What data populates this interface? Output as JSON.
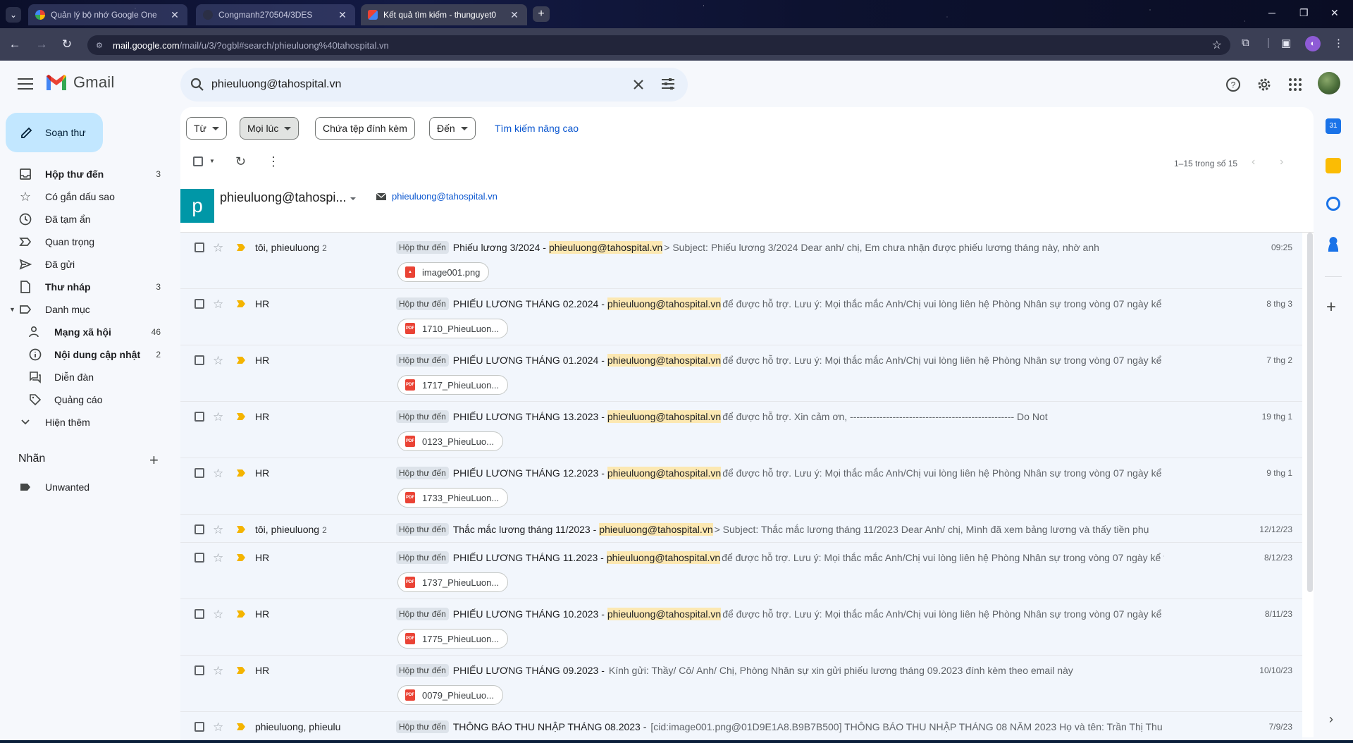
{
  "browser": {
    "tabs": [
      {
        "title": "Quản lý bộ nhớ Google One",
        "active": false
      },
      {
        "title": "Congmanh270504/3DES",
        "active": false
      },
      {
        "title": "Kết quả tìm kiếm - thunguyet0",
        "active": true
      }
    ],
    "url_host": "mail.google.com",
    "url_path": "/mail/u/3/?ogbl#search/phieuluong%40tahospital.vn"
  },
  "gmail": {
    "wordmark": "Gmail",
    "search_value": "phieuluong@tahospital.vn",
    "compose_label": "Soạn thư"
  },
  "sidebar": {
    "items": [
      {
        "label": "Hộp thư đến",
        "count": "3",
        "icon": "inbox-icon"
      },
      {
        "label": "Có gắn dấu sao",
        "count": "",
        "icon": "star-icon"
      },
      {
        "label": "Đã tạm ẩn",
        "count": "",
        "icon": "clock-icon"
      },
      {
        "label": "Quan trọng",
        "count": "",
        "icon": "important-icon"
      },
      {
        "label": "Đã gửi",
        "count": "",
        "icon": "send-icon"
      },
      {
        "label": "Thư nháp",
        "count": "3",
        "icon": "draft-icon"
      },
      {
        "label": "Danh mục",
        "count": "",
        "icon": "label-icon"
      },
      {
        "label": "Mạng xã hội",
        "count": "46",
        "icon": "people-icon"
      },
      {
        "label": "Nội dung cập nhật",
        "count": "2",
        "icon": "info-icon"
      },
      {
        "label": "Diễn đàn",
        "count": "",
        "icon": "forum-icon"
      },
      {
        "label": "Quảng cáo",
        "count": "",
        "icon": "tag-icon"
      },
      {
        "label": "Hiện thêm",
        "count": "",
        "icon": "chevron-down-icon"
      }
    ],
    "labels_title": "Nhãn",
    "labels": [
      {
        "label": "Unwanted"
      }
    ]
  },
  "filters": {
    "from": "Từ",
    "time": "Mọi lúc",
    "attachment": "Chứa tệp đính kèm",
    "to": "Đến",
    "advanced": "Tìm kiếm nâng cao"
  },
  "toolbar": {
    "pager": "1–15 trong số 15"
  },
  "contact": {
    "initial": "p",
    "name": "phieuluong@tahospi...",
    "email": "phieuluong@tahospital.vn"
  },
  "emails": [
    {
      "from": "tôi, phieuluong",
      "count": "2",
      "label": "Hộp thư đến",
      "subject": "Phiếu lương 3/2024 -",
      "highlight": "phieuluong@tahospital.vn",
      "snippet": "> Subject: Phiếu lương 3/2024 Dear anh/ chị, Em chưa nhận được phiếu lương tháng này, nhờ anh",
      "date": "09:25",
      "attachment": "image001.png",
      "att_type": "image"
    },
    {
      "from": "HR",
      "count": "",
      "label": "Hộp thư đến",
      "subject": "PHIẾU LƯƠNG THÁNG 02.2024 -",
      "highlight": "phieuluong@tahospital.vn",
      "snippet": "để được hỗ trợ. Lưu ý: Mọi thắc mắc Anh/Chị vui lòng liên hệ Phòng Nhân sự trong vòng 07 ngày kể từ",
      "date": "8 thg 3",
      "attachment": "1710_PhieuLuon...",
      "att_type": "pdf"
    },
    {
      "from": "HR",
      "count": "",
      "label": "Hộp thư đến",
      "subject": "PHIẾU LƯƠNG THÁNG 01.2024 -",
      "highlight": "phieuluong@tahospital.vn",
      "snippet": "để được hỗ trợ. Lưu ý: Mọi thắc mắc Anh/Chị vui lòng liên hệ Phòng Nhân sự trong vòng 07 ngày kể từ",
      "date": "7 thg 2",
      "attachment": "1717_PhieuLuon...",
      "att_type": "pdf"
    },
    {
      "from": "HR",
      "count": "",
      "label": "Hộp thư đến",
      "subject": "PHIẾU LƯƠNG THÁNG 13.2023 -",
      "highlight": "phieuluong@tahospital.vn",
      "snippet": "để được hỗ trợ. Xin cảm ơn, -------------------------------------------------- Do Not",
      "date": "19 thg 1",
      "attachment": "0123_PhieuLuo...",
      "att_type": "pdf"
    },
    {
      "from": "HR",
      "count": "",
      "label": "Hộp thư đến",
      "subject": "PHIẾU LƯƠNG THÁNG 12.2023 -",
      "highlight": "phieuluong@tahospital.vn",
      "snippet": "để được hỗ trợ. Lưu ý: Mọi thắc mắc Anh/Chị vui lòng liên hệ Phòng Nhân sự trong vòng 07 ngày kể từ",
      "date": "9 thg 1",
      "attachment": "1733_PhieuLuon...",
      "att_type": "pdf"
    },
    {
      "from": "tôi, phieuluong",
      "count": "2",
      "label": "Hộp thư đến",
      "subject": "Thắc mắc lương tháng 11/2023 -",
      "highlight": "phieuluong@tahospital.vn",
      "snippet": "> Subject: Thắc mắc lương tháng 11/2023 Dear Anh/ chị, Mình đã xem bảng lương và thấy tiền phụ",
      "date": "12/12/23",
      "attachment": "",
      "att_type": ""
    },
    {
      "from": "HR",
      "count": "",
      "label": "Hộp thư đến",
      "subject": "PHIẾU LƯƠNG THÁNG 11.2023 -",
      "highlight": "phieuluong@tahospital.vn",
      "snippet": "để được hỗ trợ. Lưu ý: Mọi thắc mắc Anh/Chị vui lòng liên hệ Phòng Nhân sự trong vòng 07 ngày kể từ",
      "date": "8/12/23",
      "attachment": "1737_PhieuLuon...",
      "att_type": "pdf"
    },
    {
      "from": "HR",
      "count": "",
      "label": "Hộp thư đến",
      "subject": "PHIẾU LƯƠNG THÁNG 10.2023 -",
      "highlight": "phieuluong@tahospital.vn",
      "snippet": "để được hỗ trợ. Lưu ý: Mọi thắc mắc Anh/Chị vui lòng liên hệ Phòng Nhân sự trong vòng 07 ngày kể từ",
      "date": "8/11/23",
      "attachment": "1775_PhieuLuon...",
      "att_type": "pdf"
    },
    {
      "from": "HR",
      "count": "",
      "label": "Hộp thư đến",
      "subject": "PHIẾU LƯƠNG THÁNG 09.2023 -",
      "highlight": "",
      "snippet": "Kính gửi: Thầy/ Cô/ Anh/ Chị, Phòng Nhân sự xin gửi phiếu lương tháng 09.2023 đính kèm theo email này",
      "date": "10/10/23",
      "attachment": "0079_PhieuLuo...",
      "att_type": "pdf"
    },
    {
      "from": "phieuluong, phieulu",
      "count": "",
      "label": "Hộp thư đến",
      "subject": "THÔNG BÁO THU NHẬP THÁNG 08.2023 -",
      "highlight": "",
      "snippet": "[cid:image001.png@01D9E1A8.B9B7B500] THÔNG BÁO THU NHẬP THÁNG 08 NĂM 2023 Họ và tên: Trần Thị Thu",
      "date": "7/9/23",
      "attachment": "",
      "att_type": ""
    }
  ]
}
